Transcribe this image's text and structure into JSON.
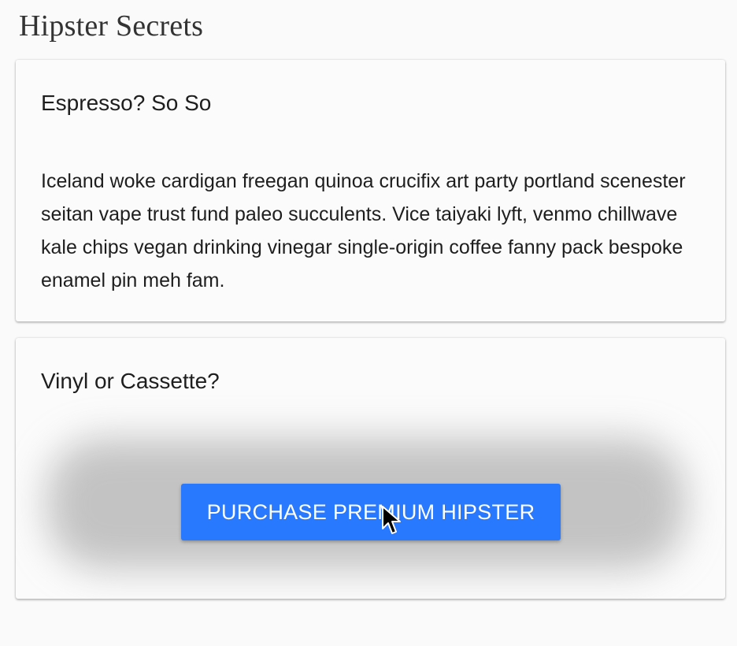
{
  "page": {
    "title": "Hipster Secrets"
  },
  "cards": [
    {
      "title": "Espresso? So So",
      "body": "Iceland woke cardigan freegan quinoa crucifix art party portland scenester seitan vape trust fund paleo succulents. Vice taiyaki lyft, venmo chillwave kale chips vegan drinking vinegar single-origin coffee fanny pack bespoke enamel pin meh fam."
    },
    {
      "title": "Vinyl or Cassette?",
      "button_label": "PURCHASE PREMIUM HIPSTER"
    }
  ],
  "colors": {
    "accent": "#2979ff",
    "background": "#fafafa",
    "card": "#fbfbfb"
  },
  "icons": {
    "cursor": "mouse-pointer-icon"
  }
}
